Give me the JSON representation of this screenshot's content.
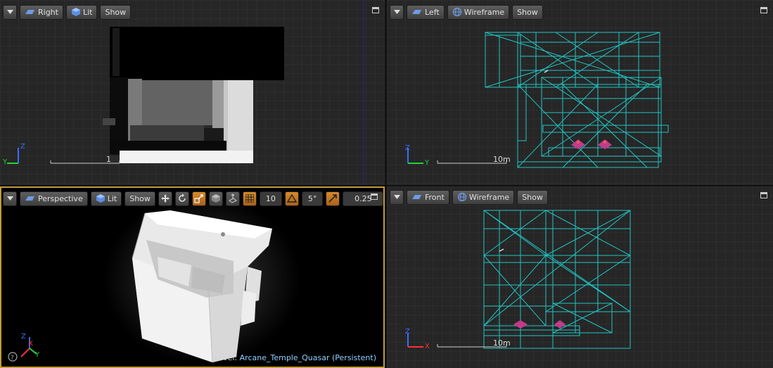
{
  "viewports": {
    "right": {
      "view_label": "Right",
      "mode_label": "Lit",
      "show_label": "Show",
      "scale_label": "1",
      "axis_a": "Z",
      "axis_b": "Y"
    },
    "left": {
      "view_label": "Left",
      "mode_label": "Wireframe",
      "show_label": "Show",
      "scale_label": "10m",
      "axis_a": "Z",
      "axis_b": "Y"
    },
    "perspective": {
      "view_label": "Perspective",
      "mode_label": "Lit",
      "show_label": "Show",
      "grid_snap_value": "10",
      "rotation_snap_value": "5°",
      "scale_snap_value": "0.25",
      "level_prefix": "Level:",
      "level_name": "Arcane_Temple_Quasar (Persistent)",
      "axis_z": "Z",
      "axis_x": "X",
      "axis_y": "Y"
    },
    "front": {
      "view_label": "Front",
      "mode_label": "Wireframe",
      "show_label": "Show",
      "scale_label": "10m",
      "axis_a": "Z",
      "axis_b": "X"
    }
  },
  "colors": {
    "wireframe": "#21c4c4",
    "accent_orange": "#d7892a",
    "active_border": "#c39a3a",
    "axis_green": "#23d33a",
    "axis_blue": "#3b6dff",
    "axis_red": "#ff3030"
  }
}
